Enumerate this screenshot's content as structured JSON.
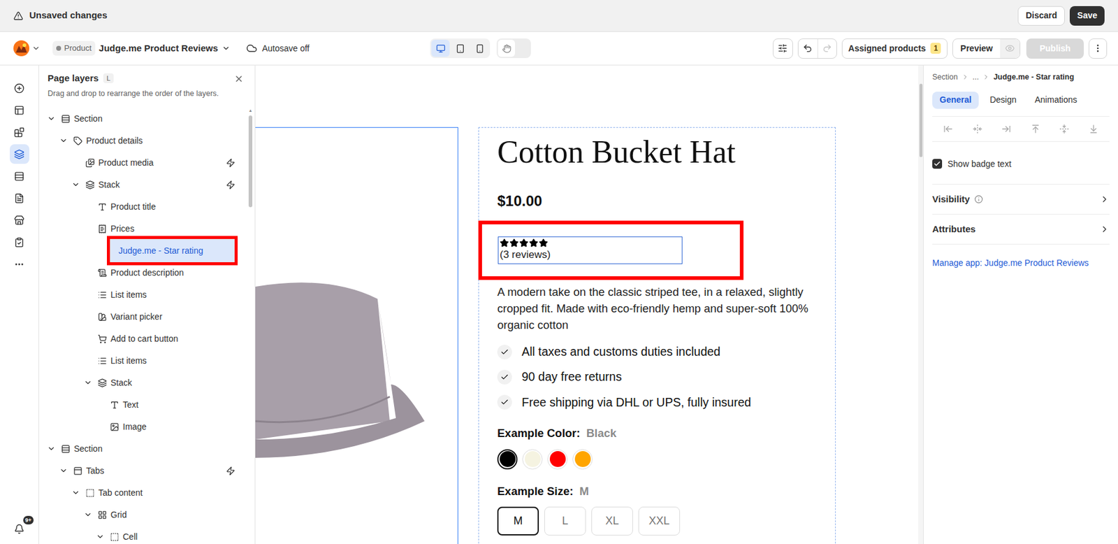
{
  "topbar": {
    "status": "Unsaved changes",
    "discard": "Discard",
    "save": "Save"
  },
  "toolbar": {
    "page_type": "Product",
    "page_name": "Judge.me Product Reviews",
    "autosave": "Autosave off",
    "devices": [
      {
        "kind": "desktop",
        "selected": true
      },
      {
        "kind": "tablet",
        "selected": false
      },
      {
        "kind": "mobile",
        "selected": false
      }
    ],
    "hand_tool": {
      "selected": false
    },
    "undo": {
      "disabled": false
    },
    "redo": {
      "disabled": true
    },
    "assigned": {
      "label": "Assigned products",
      "count": "1"
    },
    "preview": "Preview",
    "publish": {
      "label": "Publish",
      "disabled": true
    }
  },
  "rail": {
    "items": [
      {
        "kind": "add",
        "selected": false
      },
      {
        "kind": "sections",
        "selected": false
      },
      {
        "kind": "elements",
        "selected": false
      },
      {
        "kind": "layers",
        "selected": true
      },
      {
        "kind": "templates",
        "selected": false
      },
      {
        "kind": "pages",
        "selected": false
      },
      {
        "kind": "store",
        "selected": false
      },
      {
        "kind": "checklist",
        "selected": false
      },
      {
        "kind": "more",
        "selected": false
      }
    ],
    "notifications": "9+"
  },
  "layers": {
    "title": "Page layers",
    "shortcut": "L",
    "subtitle": "Drag and drop to rearrange the order of the layers.",
    "items": [
      {
        "label": "Section",
        "depth": 0,
        "kind": "section",
        "expanded": true,
        "dynamic": false,
        "selected": false,
        "annotated": false
      },
      {
        "label": "Product details",
        "depth": 1,
        "kind": "product",
        "expanded": true,
        "dynamic": false,
        "selected": false,
        "annotated": false
      },
      {
        "label": "Product media",
        "depth": 2,
        "kind": "media",
        "dynamic": true,
        "selected": false,
        "annotated": false
      },
      {
        "label": "Stack",
        "depth": 2,
        "kind": "stack",
        "expanded": true,
        "dynamic": true,
        "selected": false,
        "annotated": false
      },
      {
        "label": "Product title",
        "depth": 3,
        "kind": "title",
        "dynamic": false,
        "selected": false,
        "annotated": false
      },
      {
        "label": "Prices",
        "depth": 3,
        "kind": "prices",
        "dynamic": false,
        "selected": false,
        "annotated": false
      },
      {
        "label": "Judge.me - Star rating",
        "depth": 3,
        "kind": "app",
        "dynamic": false,
        "selected": true,
        "annotated": true
      },
      {
        "label": "Product description",
        "depth": 3,
        "kind": "description",
        "dynamic": false,
        "selected": false,
        "annotated": false
      },
      {
        "label": "List items",
        "depth": 3,
        "kind": "list",
        "dynamic": false,
        "selected": false,
        "annotated": false
      },
      {
        "label": "Variant picker",
        "depth": 3,
        "kind": "variant",
        "dynamic": false,
        "selected": false,
        "annotated": false
      },
      {
        "label": "Add to cart button",
        "depth": 3,
        "kind": "cart",
        "dynamic": false,
        "selected": false,
        "annotated": false
      },
      {
        "label": "List items",
        "depth": 3,
        "kind": "list",
        "dynamic": false,
        "selected": false,
        "annotated": false
      },
      {
        "label": "Stack",
        "depth": 3,
        "kind": "stack",
        "expanded": true,
        "dynamic": false,
        "selected": false,
        "annotated": false
      },
      {
        "label": "Text",
        "depth": 4,
        "kind": "text",
        "dynamic": false,
        "selected": false,
        "annotated": false
      },
      {
        "label": "Image",
        "depth": 4,
        "kind": "image",
        "dynamic": false,
        "selected": false,
        "annotated": false
      },
      {
        "label": "Section",
        "depth": 0,
        "kind": "section",
        "expanded": true,
        "dynamic": false,
        "selected": false,
        "annotated": false
      },
      {
        "label": "Tabs",
        "depth": 1,
        "kind": "tabs",
        "expanded": true,
        "dynamic": true,
        "selected": false,
        "annotated": false
      },
      {
        "label": "Tab content",
        "depth": 2,
        "kind": "tab-content",
        "expanded": true,
        "dynamic": false,
        "selected": false,
        "annotated": false
      },
      {
        "label": "Grid",
        "depth": 3,
        "kind": "grid",
        "expanded": true,
        "dynamic": false,
        "selected": false,
        "annotated": false
      },
      {
        "label": "Cell",
        "depth": 4,
        "kind": "cell",
        "expanded": true,
        "dynamic": false,
        "selected": false,
        "annotated": false
      }
    ]
  },
  "canvas": {
    "media_selected": true,
    "product": {
      "title": "Cotton Bucket Hat",
      "price": "$10.00",
      "rating": {
        "stars": 5,
        "reviews": "(3 reviews)",
        "selected": true,
        "annotated": true
      },
      "description": "A modern take on the classic striped tee, in a relaxed, slightly cropped fit. Made with eco-friendly hemp and super-soft 100% organic cotton",
      "features": [
        "All taxes and customs duties included",
        "90 day free returns",
        "Free shipping via DHL or UPS, fully insured"
      ],
      "color_option": {
        "label": "Example Color:",
        "value": "Black",
        "swatches": [
          {
            "color": "#000000",
            "selected": true
          },
          {
            "color": "#f5f3e1",
            "selected": false
          },
          {
            "color": "#ff0000",
            "selected": false
          },
          {
            "color": "#ffa500",
            "selected": false
          }
        ]
      },
      "size_option": {
        "label": "Example Size:",
        "value": "M",
        "options": [
          {
            "label": "M",
            "selected": true
          },
          {
            "label": "L",
            "selected": false
          },
          {
            "label": "XL",
            "selected": false
          },
          {
            "label": "XXL",
            "selected": false
          }
        ]
      }
    }
  },
  "inspector": {
    "breadcrumb": [
      "Section",
      "...",
      "Judge.me - Star rating"
    ],
    "tabs": [
      {
        "label": "General",
        "selected": true
      },
      {
        "label": "Design",
        "selected": false
      },
      {
        "label": "Animations",
        "selected": false
      }
    ],
    "alignment": [
      {
        "kind": "left"
      },
      {
        "kind": "center-h"
      },
      {
        "kind": "right"
      },
      {
        "kind": "top"
      },
      {
        "kind": "center-v"
      },
      {
        "kind": "bottom"
      }
    ],
    "show_badge_text": {
      "label": "Show badge text",
      "checked": true
    },
    "sections": [
      {
        "label": "Visibility",
        "info": true
      },
      {
        "label": "Attributes",
        "info": false
      }
    ],
    "link": "Manage app: Judge.me Product Reviews"
  }
}
